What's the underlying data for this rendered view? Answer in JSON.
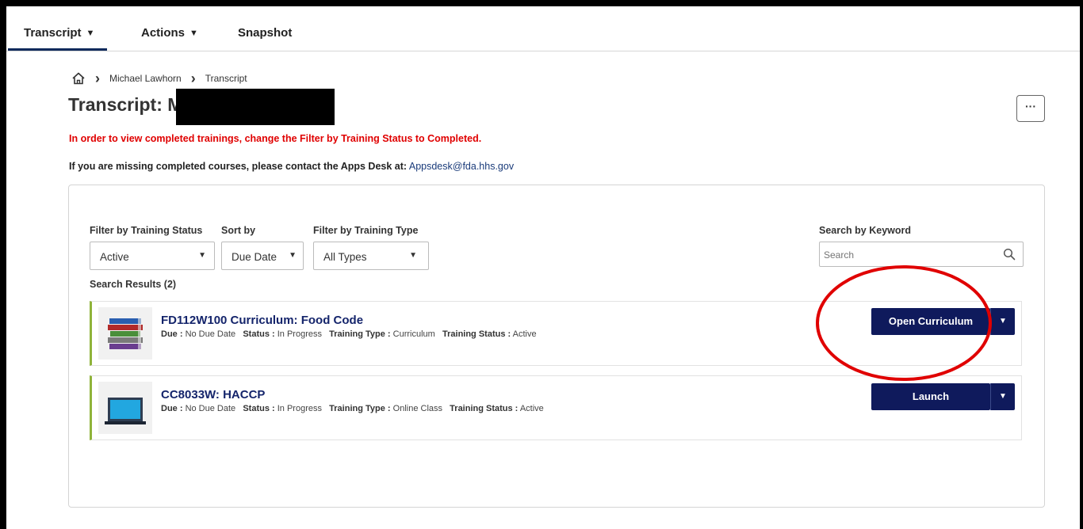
{
  "nav": {
    "tabs": [
      {
        "label": "Transcript",
        "has_caret": true,
        "active": true
      },
      {
        "label": "Actions",
        "has_caret": true,
        "active": false
      },
      {
        "label": "Snapshot",
        "has_caret": false,
        "active": false
      }
    ],
    "caret": "▼"
  },
  "breadcrumb": {
    "home_icon": "home-icon",
    "items": [
      "Michael Lawhorn",
      "Transcript"
    ],
    "separator": "›"
  },
  "page": {
    "title": "Transcript: M",
    "more_label": "···",
    "alert": "In order to view completed trainings, change the Filter by Training Status to Completed.",
    "info_prefix": "If you are missing completed courses, please contact the Apps Desk at:",
    "info_email": "Appsdesk@fda.hhs.gov"
  },
  "filters": {
    "status_label": "Filter by Training Status",
    "status_value": "Active",
    "sort_label": "Sort by",
    "sort_value": "Due Date",
    "type_label": "Filter by Training Type",
    "type_value": "All Types",
    "keyword_label": "Search by Keyword",
    "keyword_placeholder": "Search",
    "arrow": "▼"
  },
  "results": {
    "label": "Search Results (2)",
    "items": [
      {
        "title": "FD112W100 Curriculum: Food Code",
        "thumb_icon": "books-icon",
        "due_label": "Due :",
        "due": "No Due Date",
        "status_label": "Status :",
        "status": "In Progress",
        "type_label": "Training Type :",
        "type": "Curriculum",
        "tstatus_label": "Training Status :",
        "tstatus": "Active",
        "action": "Open Curriculum"
      },
      {
        "title": "CC8033W: HACCP",
        "thumb_icon": "laptop-icon",
        "due_label": "Due :",
        "due": "No Due Date",
        "status_label": "Status :",
        "status": "In Progress",
        "type_label": "Training Type :",
        "type": "Online Class",
        "tstatus_label": "Training Status :",
        "tstatus": "Active",
        "action": "Launch"
      }
    ]
  },
  "colors": {
    "nav_underline": "#0e2a5c",
    "alert": "#e00000",
    "button": "#0f1a5c",
    "title_link": "#14246b",
    "row_accent": "#8fb33a",
    "annotation": "#e00000"
  }
}
